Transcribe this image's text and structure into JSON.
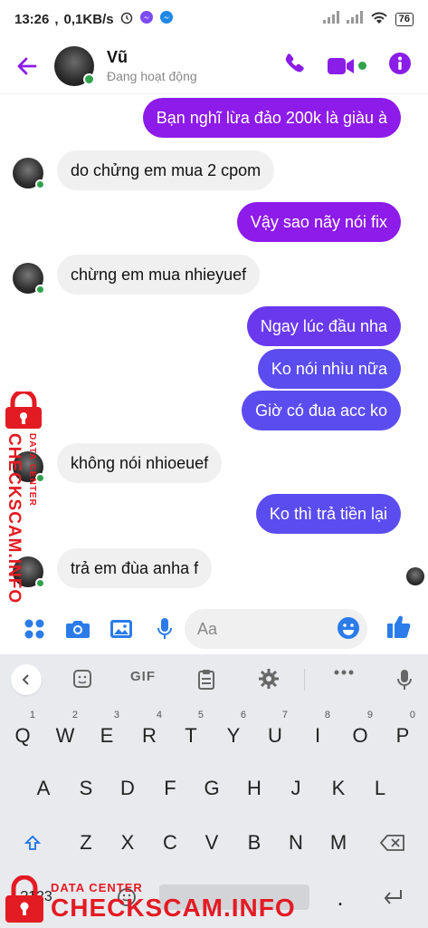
{
  "status_bar": {
    "time": "13:26",
    "speed": "0,1KB/s",
    "battery": "76"
  },
  "header": {
    "name": "Vũ",
    "status": "Đang hoạt động",
    "back_icon": "arrow-left-icon",
    "call_icon": "phone-icon",
    "video_icon": "video-camera-icon",
    "info_icon": "info-icon",
    "accent": "#8a1de8"
  },
  "messages": [
    {
      "side": "out",
      "text": "Bạn nghĩ lừa đảo 200k là giàu à"
    },
    {
      "side": "in",
      "text": "do chửng em mua 2 cpom"
    },
    {
      "side": "out",
      "text": "Vậy sao nãy nói fix"
    },
    {
      "side": "in",
      "text": "chừng em mua nhieyuef"
    },
    {
      "side": "out",
      "text": "Ngay lúc đầu nha"
    },
    {
      "side": "out",
      "text": "Ko nói nhìu nữa"
    },
    {
      "side": "out",
      "text": "Giờ có đua acc ko"
    },
    {
      "side": "in",
      "text": "không nói nhioeuef"
    },
    {
      "side": "out",
      "text": "Ko thì trả tiền lại"
    },
    {
      "side": "in",
      "text": "trả em đùa anha f"
    }
  ],
  "composer": {
    "placeholder": "Aa",
    "icons": [
      "grid-icon",
      "camera-icon",
      "image-icon",
      "microphone-icon",
      "emoji-icon",
      "thumbs-up-icon"
    ]
  },
  "keyboard": {
    "toolbar": [
      "chevron-left-icon",
      "sticker-icon",
      "GIF",
      "clipboard-icon",
      "gear-icon",
      "more-icon",
      "microphone-icon"
    ],
    "gif_label": "GIF",
    "row1": [
      {
        "k": "Q",
        "s": "1"
      },
      {
        "k": "W",
        "s": "2"
      },
      {
        "k": "E",
        "s": "3"
      },
      {
        "k": "R",
        "s": "4"
      },
      {
        "k": "T",
        "s": "5"
      },
      {
        "k": "Y",
        "s": "6"
      },
      {
        "k": "U",
        "s": "7"
      },
      {
        "k": "I",
        "s": "8"
      },
      {
        "k": "O",
        "s": "9"
      },
      {
        "k": "P",
        "s": "0"
      }
    ],
    "row2": [
      "A",
      "S",
      "D",
      "F",
      "G",
      "H",
      "J",
      "K",
      "L"
    ],
    "row3": [
      "Z",
      "X",
      "C",
      "V",
      "B",
      "N",
      "M"
    ],
    "num_key": "?123",
    "colors": {
      "bg": "#e9eaee",
      "shift": "#1a73e8"
    }
  },
  "watermark": {
    "small": "DATA CENTER",
    "large": "CHECKSCAM.INFO",
    "color": "#e31b23"
  }
}
